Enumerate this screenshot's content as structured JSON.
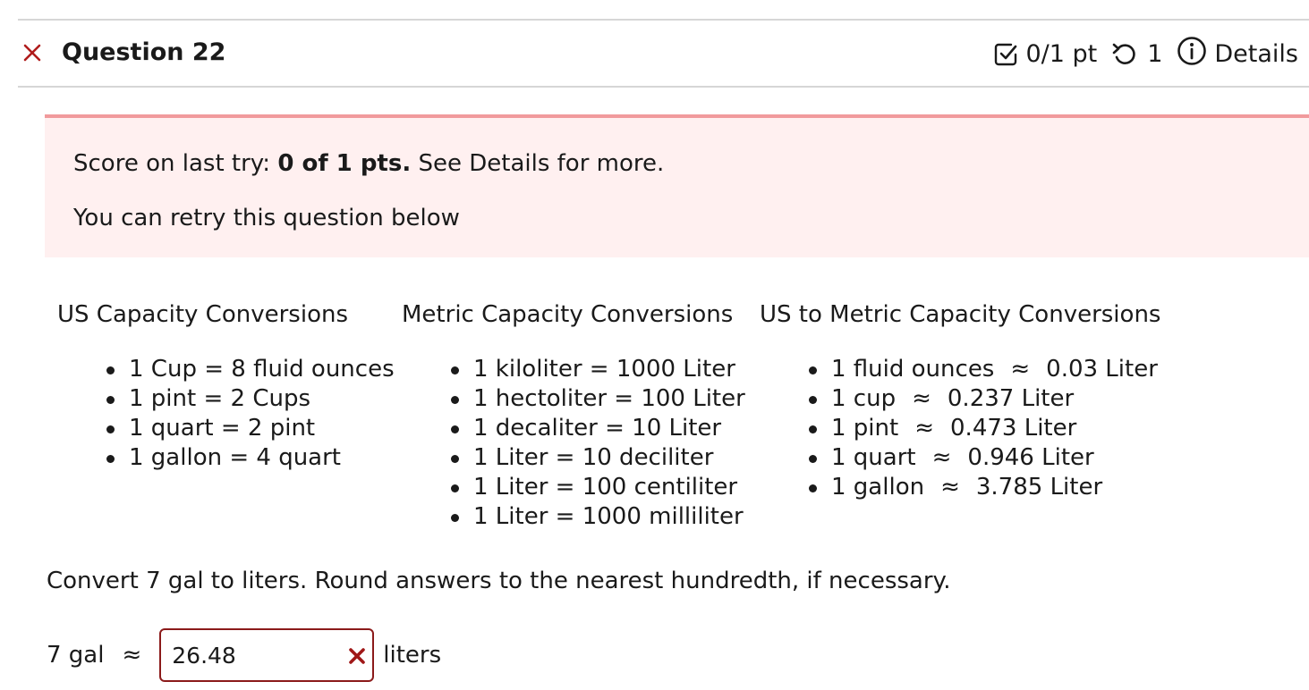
{
  "header": {
    "title": "Question 22",
    "score": "0/1 pt",
    "retries": "1",
    "details_label": "Details",
    "icons": {
      "close": "close-x-icon",
      "score": "checkbox-icon",
      "retry": "retry-icon",
      "details": "info-icon"
    }
  },
  "alert": {
    "prefix": "Score on last try: ",
    "score_bold": "0 of 1 pts.",
    "suffix": " See Details for more.",
    "retry_text": "You can retry this question below"
  },
  "columns": [
    {
      "title": "US Capacity Conversions",
      "items": [
        "1 Cup = 8 fluid ounces",
        "1 pint = 2 Cups",
        "1 quart = 2 pint",
        "1 gallon = 4 quart"
      ]
    },
    {
      "title": "Metric Capacity Conversions",
      "items": [
        "1 kiloliter = 1000 Liter",
        "1 hectoliter = 100 Liter",
        "1 decaliter = 10 Liter",
        "1 Liter = 10 deciliter",
        "1 Liter = 100 centiliter",
        "1 Liter = 1000 milliliter"
      ]
    },
    {
      "title": "US to Metric Capacity Conversions",
      "approx_symbol": "≈",
      "items": [
        {
          "left": "1 fluid ounces",
          "right": "0.03 Liter"
        },
        {
          "left": "1 cup",
          "right": "0.237 Liter"
        },
        {
          "left": "1 pint",
          "right": "0.473 Liter"
        },
        {
          "left": "1 quart",
          "right": "0.946 Liter"
        },
        {
          "left": "1 gallon",
          "right": "3.785 Liter"
        }
      ]
    }
  ],
  "prompt": "Convert 7 gal to liters. Round answers to the nearest hundredth, if necessary.",
  "answer": {
    "left_label": "7 gal",
    "approx_symbol": "≈",
    "value": "26.48",
    "unit": "liters",
    "status": "incorrect"
  },
  "colors": {
    "accent_red": "#b01c1c",
    "alert_bg": "#fff0f0",
    "alert_border": "#f19a9c",
    "input_border": "#8b1a1a"
  }
}
